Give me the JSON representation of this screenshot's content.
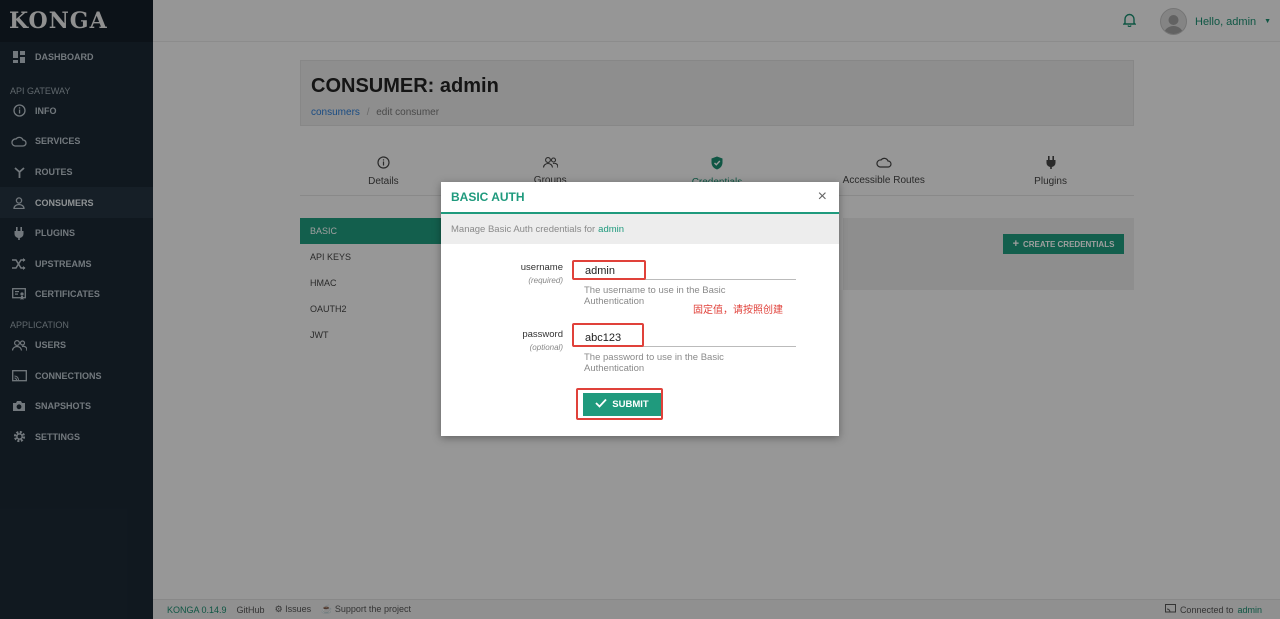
{
  "sidebar": {
    "logo": "KONGA",
    "dashboard": "DASHBOARD",
    "section_api": "API GATEWAY",
    "info": "INFO",
    "services": "SERVICES",
    "routes": "ROUTES",
    "consumers": "CONSUMERS",
    "plugins": "PLUGINS",
    "upstreams": "UPSTREAMS",
    "certificates": "CERTIFICATES",
    "section_app": "APPLICATION",
    "users": "USERS",
    "connections": "CONNECTIONS",
    "snapshots": "SNAPSHOTS",
    "settings": "SETTINGS"
  },
  "topbar": {
    "hello": "Hello, admin"
  },
  "page": {
    "title": "CONSUMER: admin",
    "breadcrumb_link": "consumers",
    "breadcrumb_sep": "/",
    "breadcrumb_current": "edit consumer"
  },
  "tabs": {
    "details": "Details",
    "groups": "Groups",
    "credentials": "Credentials",
    "routes": "Accessible Routes",
    "plugins": "Plugins"
  },
  "credentials": {
    "basic": "BASIC",
    "api_keys": "API KEYS",
    "hmac": "HMAC",
    "oauth2": "OAUTH2",
    "jwt": "JWT",
    "create": "CREATE CREDENTIALS"
  },
  "modal": {
    "title": "BASIC AUTH",
    "close": "×",
    "subtitle": "Manage Basic Auth credentials for",
    "subtitle_user": "admin",
    "username_label": "username",
    "username_hint": "(required)",
    "username_value": "admin",
    "username_help": "The username to use in the Basic Authentication",
    "password_label": "password",
    "password_hint": "(optional)",
    "password_value": "abc123",
    "password_help": "The password to use in the Basic Authentication",
    "annotation": "固定值，请按照创建",
    "submit": "SUBMIT"
  },
  "footer": {
    "version": "KONGA 0.14.9",
    "github": "GitHub",
    "issues": "Issues",
    "support": "Support the project",
    "connected": "Connected to",
    "connected_name": "admin"
  },
  "colors": {
    "accent": "#1f9a7d",
    "sidebar": "#1b2833",
    "highlight": "#e0413a"
  }
}
